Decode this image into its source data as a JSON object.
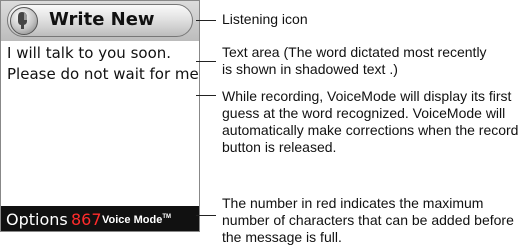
{
  "phone": {
    "title": "Write New",
    "text_lines": [
      "I will talk to you soon.",
      "Please do not wait for me"
    ],
    "options_label": "Options",
    "char_count": "867",
    "brand": "Voice Mode",
    "brand_tm": "TM",
    "colors": {
      "count_red": "#ff2b2b",
      "bar": "#111111"
    }
  },
  "annotations": {
    "listening": "Listening icon",
    "textarea": "Text area (The word dictated most recently is shown in shadowed text .)",
    "recording": "While recording, VoiceMode will display its first guess at the word recognized. VoiceMode will automatically make corrections when the record button is released.",
    "count": "The number in red indicates the maximum number of characters that can be added before the message is full."
  }
}
